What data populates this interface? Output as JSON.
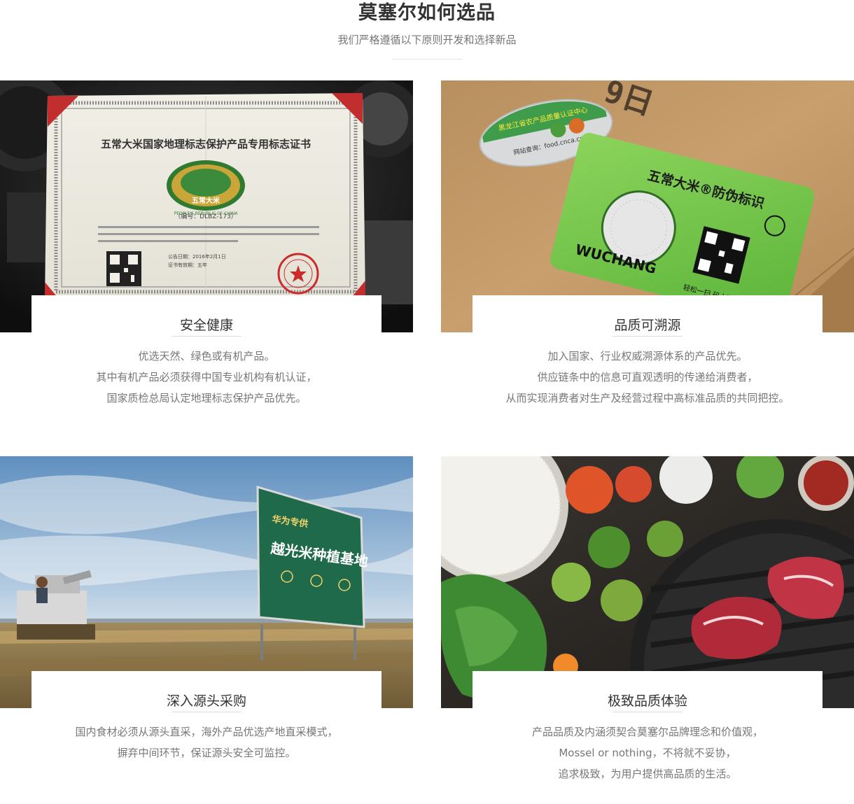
{
  "header": {
    "title": "莫塞尔如何选品",
    "subtitle": "我们严格遵循以下原则开发和选择新品"
  },
  "cards": [
    {
      "title": "安全健康",
      "image_icon": "pgi-certificate-photo",
      "image_text": {
        "cert_title": "五常大米国家地理标志保护产品专用标志证书",
        "seal_text": "五常大米",
        "seal_caption": "PEOPLE'S REPUBLIC OF CHINA",
        "cert_number": "（编号：DLBZ-173）",
        "issue_date": "公告日期：2016年2月1日",
        "valid": "证书有效期：五年"
      },
      "lines": [
        "优选天然、绿色或有机产品。",
        "其中有机产品必须获得中国专业机构有机认证，",
        "国家质检总局认定地理标志保护产品优先。"
      ]
    },
    {
      "title": "品质可溯源",
      "image_icon": "anti-counterfeit-label-photo",
      "image_text": {
        "label_main": "五常大米®防伪标识",
        "brand": "WUCHANG",
        "scan": "轻松一扫 码上溯源",
        "round_sticker": "黑龙江省农产品质量认证中心",
        "site": "网站查询：food.cnca.cn",
        "box_print": "9日"
      },
      "lines": [
        "加入国家、行业权威溯源体系的产品优先。",
        "供应链条中的信息可直观透明的传递给消费者，",
        "从而实现消费者对生产及经营过程中高标准品质的共同把控。"
      ]
    },
    {
      "title": "深入源头采购",
      "image_icon": "rice-field-billboard-photo",
      "image_text": {
        "billboard_top": "华为专供",
        "billboard_main": "越光米种植基地"
      },
      "lines": [
        "国内食材必须从源头直采，海外产品优选产地直采模式，",
        "摒弃中间环节，保证源头安全可监控。"
      ]
    },
    {
      "title": "极致品质体验",
      "image_icon": "fresh-food-ingredients-photo",
      "lines": [
        "产品品质及内涵须契合莫塞尔品牌理念和价值观，",
        "Mossel or nothing，不将就不妥协，",
        "追求极致，为用户提供高品质的生活。"
      ]
    }
  ]
}
